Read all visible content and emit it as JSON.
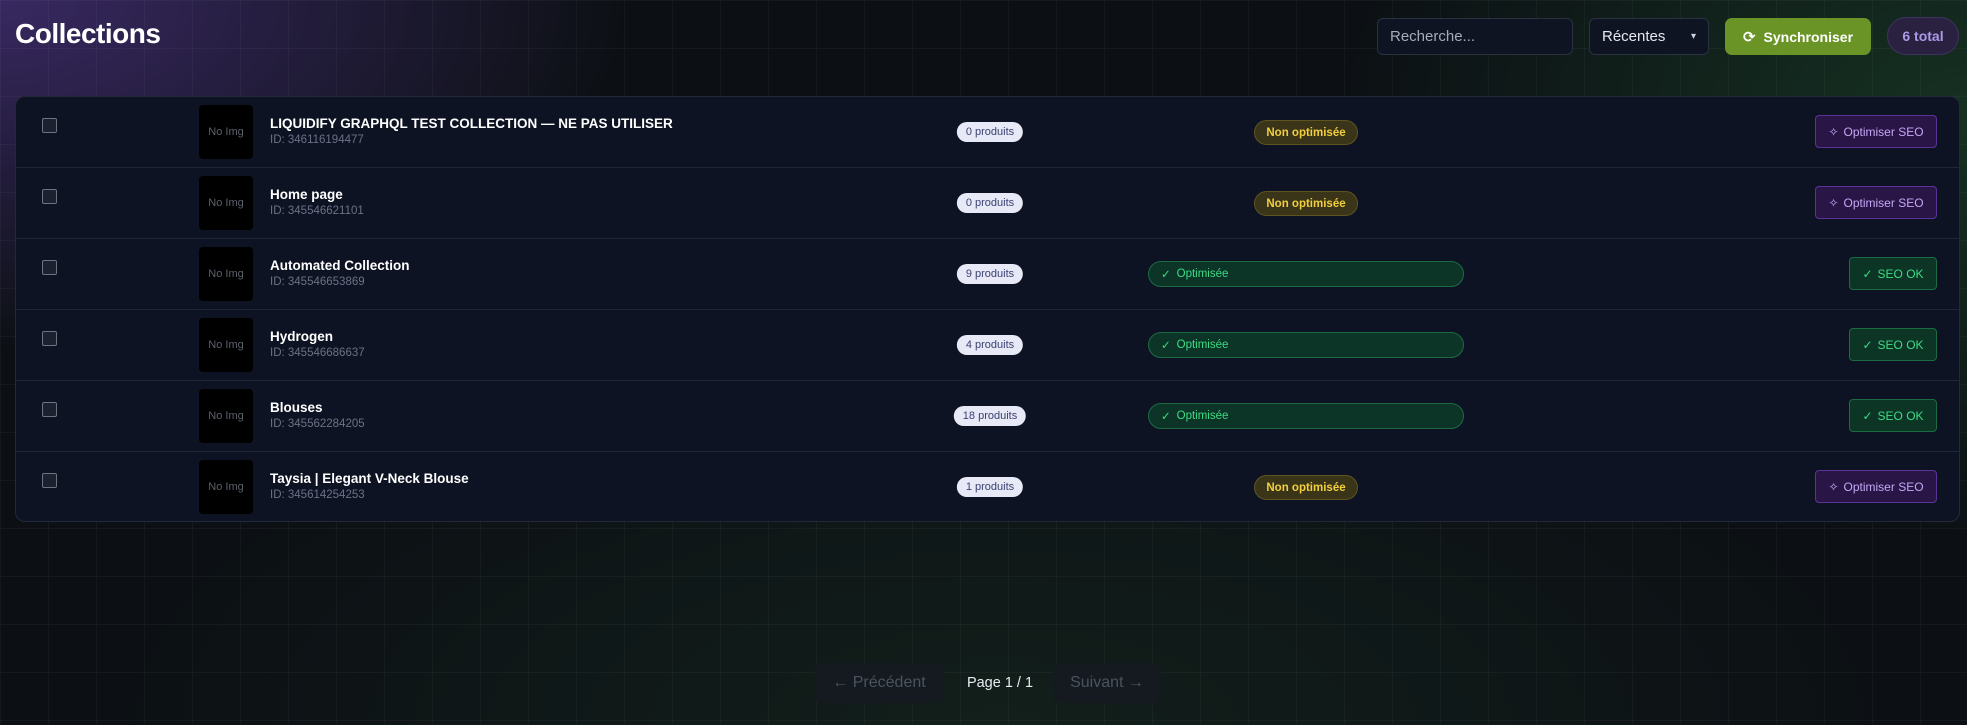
{
  "header": {
    "title": "Collections",
    "search_placeholder": "Recherche...",
    "sort_value": "Récentes",
    "sync_label": "Synchroniser",
    "total_label": "6 total"
  },
  "rows": [
    {
      "name": "LIQUIDIFY GRAPHQL TEST COLLECTION — NE PAS UTILISER",
      "id": "ID: 346116194477",
      "thumb": "No Img",
      "count": "0 produits",
      "status": "Non optimisée",
      "optimized": false,
      "action": "Optimiser SEO"
    },
    {
      "name": "Home page",
      "id": "ID: 345546621101",
      "thumb": "No Img",
      "count": "0 produits",
      "status": "Non optimisée",
      "optimized": false,
      "action": "Optimiser SEO"
    },
    {
      "name": "Automated Collection",
      "id": "ID: 345546653869",
      "thumb": "No Img",
      "count": "9 produits",
      "status": "Optimisée",
      "optimized": true,
      "action": "SEO OK"
    },
    {
      "name": "Hydrogen",
      "id": "ID: 345546686637",
      "thumb": "No Img",
      "count": "4 produits",
      "status": "Optimisée",
      "optimized": true,
      "action": "SEO OK"
    },
    {
      "name": "Blouses",
      "id": "ID: 345562284205",
      "thumb": "No Img",
      "count": "18 produits",
      "status": "Optimisée",
      "optimized": true,
      "action": "SEO OK"
    },
    {
      "name": "Taysia | Elegant V-Neck Blouse",
      "id": "ID: 345614254253",
      "thumb": "No Img",
      "count": "1 produits",
      "status": "Non optimisée",
      "optimized": false,
      "action": "Optimiser SEO"
    }
  ],
  "pagination": {
    "prev_label": "← Précédent",
    "info": "Page 1 / 1",
    "next_label": "Suivant →"
  },
  "icons": {
    "sync": "refresh-icon",
    "sparkle": "sparkle-icon",
    "check": "check-icon",
    "chevron": "chevron-down-icon"
  },
  "colors": {
    "sync_button": "#6a9426",
    "status_not_optimized": "#f2cf3e",
    "status_optimized": "#3ddc84",
    "seo_button": "#c4a7f5",
    "total_badge": "#a99ae6"
  }
}
